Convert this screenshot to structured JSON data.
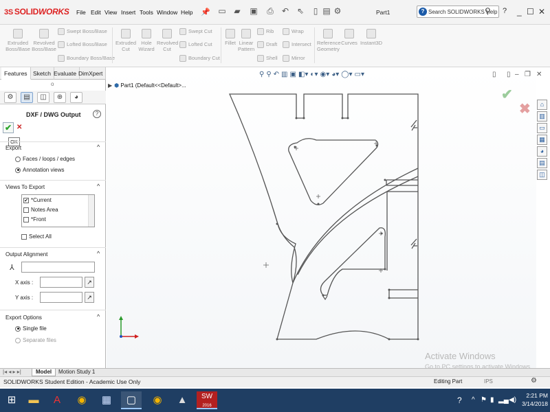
{
  "titlebar": {
    "brand_prefix": "3S",
    "brand_solid": "SOLID",
    "brand_works": "WORKS",
    "menus": [
      "File",
      "Edit",
      "View",
      "Insert",
      "Tools",
      "Window",
      "Help"
    ],
    "document": "Part1",
    "search_placeholder": "Search SOLIDWORKS Help",
    "help": "?"
  },
  "command_manager": {
    "features": {
      "extruded_boss": "Extruded Boss/Base",
      "revolved_boss": "Revolved Boss/Base",
      "swept_boss": "Swept Boss/Base",
      "lofted_boss": "Lofted Boss/Base",
      "boundary_boss": "Boundary Boss/Base",
      "extruded_cut": "Extruded Cut",
      "hole_wizard": "Hole Wizard",
      "revolved_cut": "Revolved Cut",
      "swept_cut": "Swept Cut",
      "lofted_cut": "Lofted Cut",
      "boundary_cut": "Boundary Cut",
      "fillet": "Fillet",
      "linear_pattern": "Linear Pattern",
      "rib": "Rib",
      "draft": "Draft",
      "shell": "Shell",
      "wrap": "Wrap",
      "intersect": "Intersect",
      "mirror": "Mirror",
      "reference_geometry": "Reference Geometry",
      "curves": "Curves",
      "instant3d": "Instant3D"
    }
  },
  "left_panel": {
    "tabs": [
      "Features",
      "Sketch",
      "Evaluate",
      "DimXpert"
    ],
    "title": "DXF / DWG Output",
    "help": "?",
    "ok_tooltip": "OK",
    "export_section": {
      "title": "Export",
      "options": [
        "Faces / loops / edges",
        "Annotation views"
      ],
      "selected": "Annotation views"
    },
    "views_section": {
      "title": "Views To Export",
      "items": [
        {
          "label": "*Current",
          "checked": true
        },
        {
          "label": "Notes Area",
          "checked": false
        },
        {
          "label": "*Front",
          "checked": false
        }
      ],
      "select_all": "Select All"
    },
    "alignment_section": {
      "title": "Output Alignment",
      "x_axis": "X axis :",
      "y_axis": "Y axis :"
    },
    "export_options": {
      "title": "Export Options",
      "options": [
        "Single file",
        "Separate files"
      ],
      "selected": "Single file"
    }
  },
  "canvas": {
    "tree_item": "Part1  (Default<<Default>..."
  },
  "bottom_tabs": [
    "Model",
    "Motion Study 1"
  ],
  "status": {
    "left": "SOLIDWORKS Student Edition - Academic Use Only",
    "mode": "Editing Part",
    "units": "IPS"
  },
  "watermark": {
    "line1": "Activate Windows",
    "line2": "Go to PC settings to activate Windows."
  },
  "taskbar": {
    "time": "2:21 PM",
    "date": "3/14/2018",
    "sw_label": "2016"
  },
  "colors": {
    "brand_red": "#d22222",
    "accent_blue": "#1a5aa8",
    "taskbar": "#1f3e63",
    "ok_green": "#2aa52a"
  }
}
